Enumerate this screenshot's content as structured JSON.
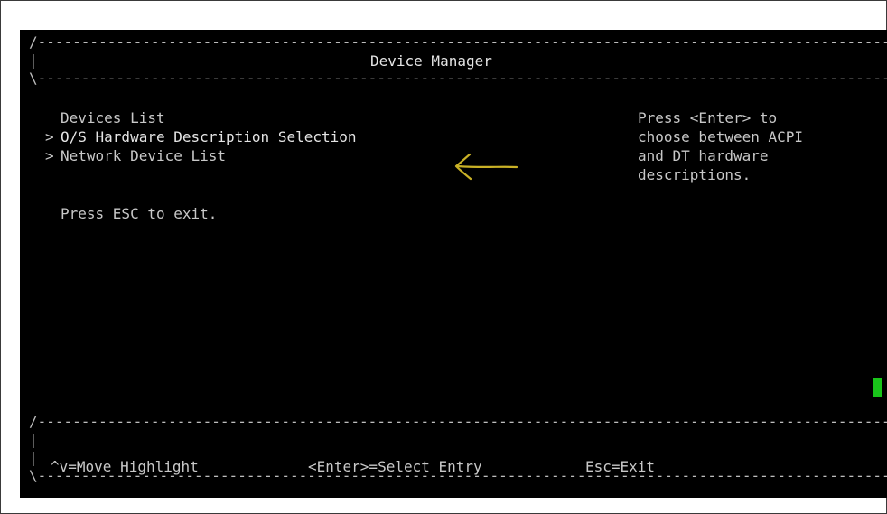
{
  "header": {
    "title": "Device Manager"
  },
  "menu": {
    "items": [
      {
        "marker": " ",
        "label": "Devices List"
      },
      {
        "marker": ">",
        "label": "O/S Hardware Description Selection"
      },
      {
        "marker": ">",
        "label": "Network Device List"
      }
    ],
    "exit_hint": "Press ESC to exit."
  },
  "help": {
    "lines": [
      "Press <Enter> to",
      "choose between ACPI",
      "and DT hardware",
      "descriptions."
    ]
  },
  "footer": {
    "move": "^v=Move Highlight",
    "select": "<Enter>=Select Entry",
    "exit": "Esc=Exit"
  },
  "colors": {
    "terminal_bg": "#000000",
    "text": "#c8c8c8",
    "cursor": "#19c51a",
    "annotation_arrow": "#c9b126"
  },
  "icons": {
    "annotation": "hand-drawn-arrow-left-icon",
    "cursor": "block-cursor-icon"
  }
}
